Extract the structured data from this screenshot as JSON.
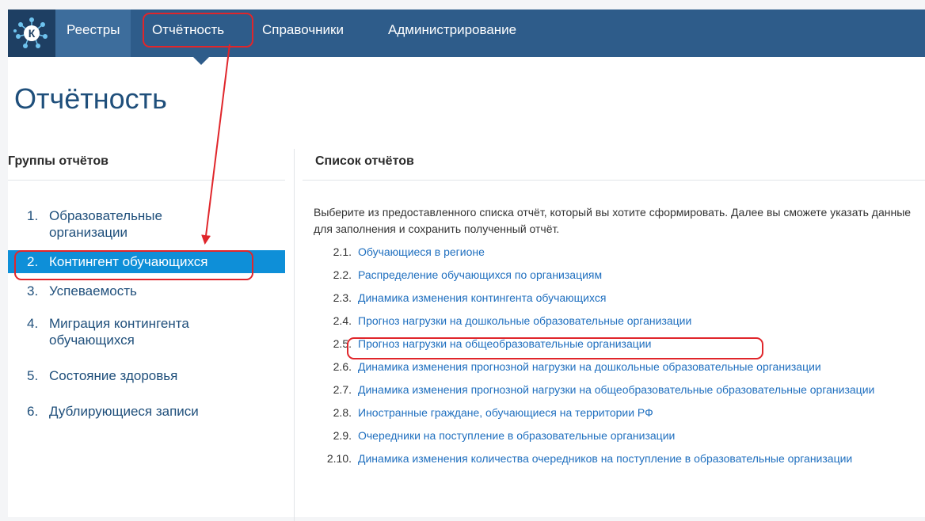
{
  "topbar": {
    "logo_letter": "К",
    "nav": [
      "Реестры",
      "Отчётность",
      "Справочники",
      "Администрирование"
    ]
  },
  "page_title": "Отчётность",
  "sidebar": {
    "heading": "Группы отчётов",
    "groups": [
      {
        "num": "1.",
        "label": "Образовательные организации"
      },
      {
        "num": "2.",
        "label": "Контингент обучающихся"
      },
      {
        "num": "3.",
        "label": "Успеваемость"
      },
      {
        "num": "4.",
        "label": "Миграция контингента обучающихся"
      },
      {
        "num": "5.",
        "label": "Состояние здоровья"
      },
      {
        "num": "6.",
        "label": "Дублирующиеся записи"
      }
    ]
  },
  "main": {
    "heading": "Список отчётов",
    "intro": "Выберите из предоставленного списка отчёт, который вы хотите сформировать. Далее вы сможете указать данные для заполнения и сохранить полученный отчёт.",
    "reports": [
      {
        "num": "2.1.",
        "label": "Обучающиеся в регионе"
      },
      {
        "num": "2.2.",
        "label": "Распределение обучающихся по организациям"
      },
      {
        "num": "2.3.",
        "label": "Динамика изменения контингента обучающихся"
      },
      {
        "num": "2.4.",
        "label": "Прогноз нагрузки на дошкольные образовательные организации"
      },
      {
        "num": "2.5.",
        "label": "Прогноз нагрузки на общеобразовательные организации"
      },
      {
        "num": "2.6.",
        "label": "Динамика изменения прогнозной нагрузки на дошкольные образовательные организации"
      },
      {
        "num": "2.7.",
        "label": "Динамика изменения прогнозной нагрузки на общеобразовательные образовательные организации"
      },
      {
        "num": "2.8.",
        "label": "Иностранные граждане, обучающиеся на территории РФ"
      },
      {
        "num": "2.9.",
        "label": "Очередники на поступление в образовательные организации"
      },
      {
        "num": "2.10.",
        "label": "Динамика изменения количества очередников на поступление в образовательные организации"
      }
    ]
  },
  "colors": {
    "topbar": "#2e5c8a",
    "active_group": "#0e8fd8",
    "link": "#1f6fbf",
    "annotation": "#e0262b"
  }
}
